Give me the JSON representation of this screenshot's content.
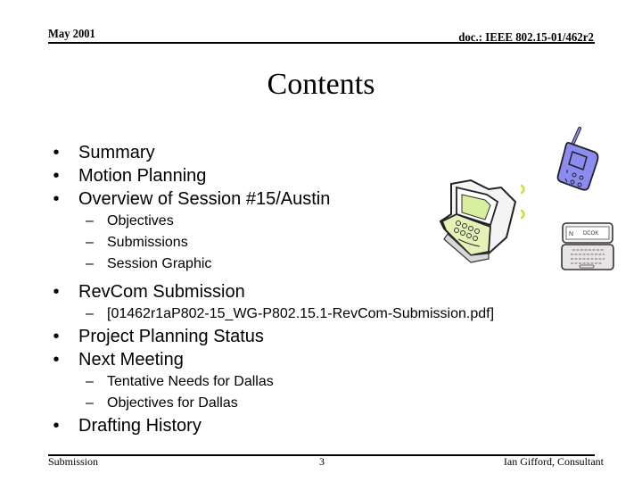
{
  "header": {
    "date": "May 2001",
    "doc_id": "doc.: IEEE 802.15-01/462r2"
  },
  "title": "Contents",
  "outline": {
    "bullet_glyph": "•",
    "dash_glyph": "–",
    "items": [
      {
        "label": "Summary"
      },
      {
        "label": "Motion Planning"
      },
      {
        "label": "Overview of Session #15/Austin",
        "children": [
          "Objectives",
          "Submissions",
          "Session Graphic"
        ]
      },
      {
        "label": "RevCom Submission",
        "children": [
          "[01462r1aP802-15_WG-P802.15.1-RevCom-Submission.pdf]"
        ]
      },
      {
        "label": "Project Planning Status"
      },
      {
        "label": "Next Meeting",
        "children": [
          "Tentative Needs for Dallas",
          "Objectives for Dallas"
        ]
      },
      {
        "label": "Drafting History"
      }
    ]
  },
  "clipart": {
    "phone": "mobile-phone-icon",
    "laptop": "laptop-icon",
    "pda": "handheld-pda-icon",
    "colors": {
      "phone": "#8C8CF0",
      "laptop_screen": "#D8EFA0",
      "signal": "#C8E040",
      "pda_body": "#E8E4E4"
    }
  },
  "footer": {
    "left": "Submission",
    "page": "3",
    "author": "Ian Gifford, Consultant"
  }
}
